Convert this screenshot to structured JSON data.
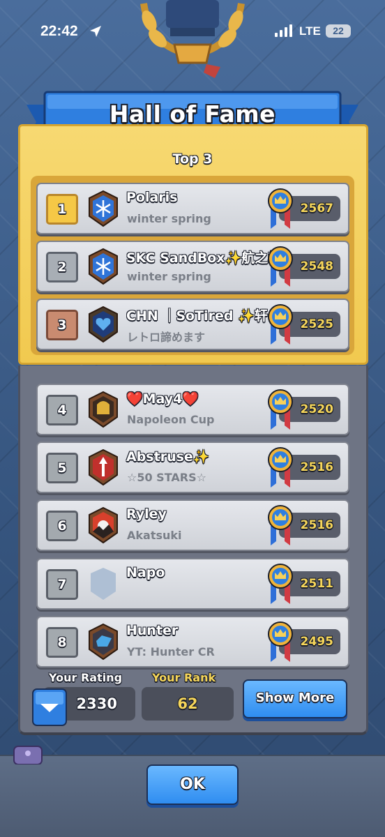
{
  "status_bar": {
    "time": "22:42",
    "network": "LTE",
    "battery": "22"
  },
  "dialog": {
    "title": "Hall of Fame",
    "top_label": "Top 3"
  },
  "players": [
    {
      "rank": "1",
      "name": "Polaris",
      "clan": "winter spring",
      "trophies": "2567",
      "badge_icon": "snowflake-badge-icon"
    },
    {
      "rank": "2",
      "name": "SKC SandBox✨航之輔",
      "clan": "winter spring",
      "trophies": "2548",
      "badge_icon": "snowflake-badge-icon"
    },
    {
      "rank": "3",
      "name": "CHN ｜SoTired ✨轩",
      "clan": "レトロ諦めます",
      "trophies": "2525",
      "badge_icon": "heart-badge-icon"
    },
    {
      "rank": "4",
      "name": "❤️May4❤️",
      "clan": "Napoleon Cup",
      "trophies": "2520",
      "badge_icon": "helmet-badge-icon"
    },
    {
      "rank": "5",
      "name": "Abstruse✨",
      "clan": "☆50 STARS☆",
      "trophies": "2516",
      "badge_icon": "arrow-badge-icon"
    },
    {
      "rank": "6",
      "name": "Ryley",
      "clan": "Akatsuki",
      "trophies": "2516",
      "badge_icon": "sunset-badge-icon"
    },
    {
      "rank": "7",
      "name": "Napo",
      "clan": "",
      "trophies": "2511",
      "badge_icon": "empty-shield-icon"
    },
    {
      "rank": "8",
      "name": "Hunter",
      "clan": "YT: Hunter CR",
      "trophies": "2495",
      "badge_icon": "gem-badge-icon"
    }
  ],
  "footer": {
    "your_rating_label": "Your Rating",
    "your_rating": "2330",
    "your_rank_label": "Your Rank",
    "your_rank": "62",
    "show_more": "Show More",
    "ok": "OK"
  },
  "colors": {
    "gold_panel": "#f1c94f",
    "button_blue": "#2f8df0",
    "trophy_text": "#f6d65a"
  }
}
